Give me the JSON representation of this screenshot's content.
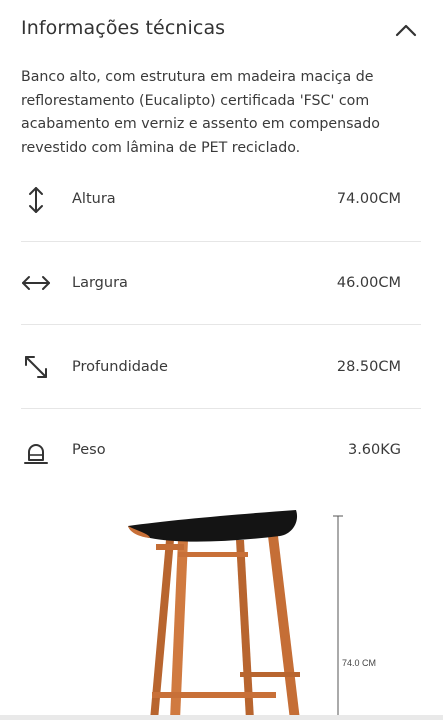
{
  "header": {
    "title": "Informações técnicas"
  },
  "description": "Banco alto, com estrutura em madeira maciça de reflorestamento (Eucalipto) certificada 'FSC' com acabamento em verniz e assento em compensado revestido com lâmina de PET reciclado.",
  "specs": [
    {
      "icon": "vertical-arrows-icon",
      "label": "Altura",
      "value": "74.00CM"
    },
    {
      "icon": "horizontal-arrows-icon",
      "label": "Largura",
      "value": "46.00CM"
    },
    {
      "icon": "diagonal-arrows-icon",
      "label": "Profundidade",
      "value": "28.50CM"
    },
    {
      "icon": "weight-icon",
      "label": "Peso",
      "value": "3.60KG"
    }
  ],
  "image": {
    "dimension_label": "74.0 CM"
  },
  "colors": {
    "text": "#333333",
    "divider": "#e6e6e6",
    "wood": "#c8703a",
    "seat": "#111111"
  }
}
